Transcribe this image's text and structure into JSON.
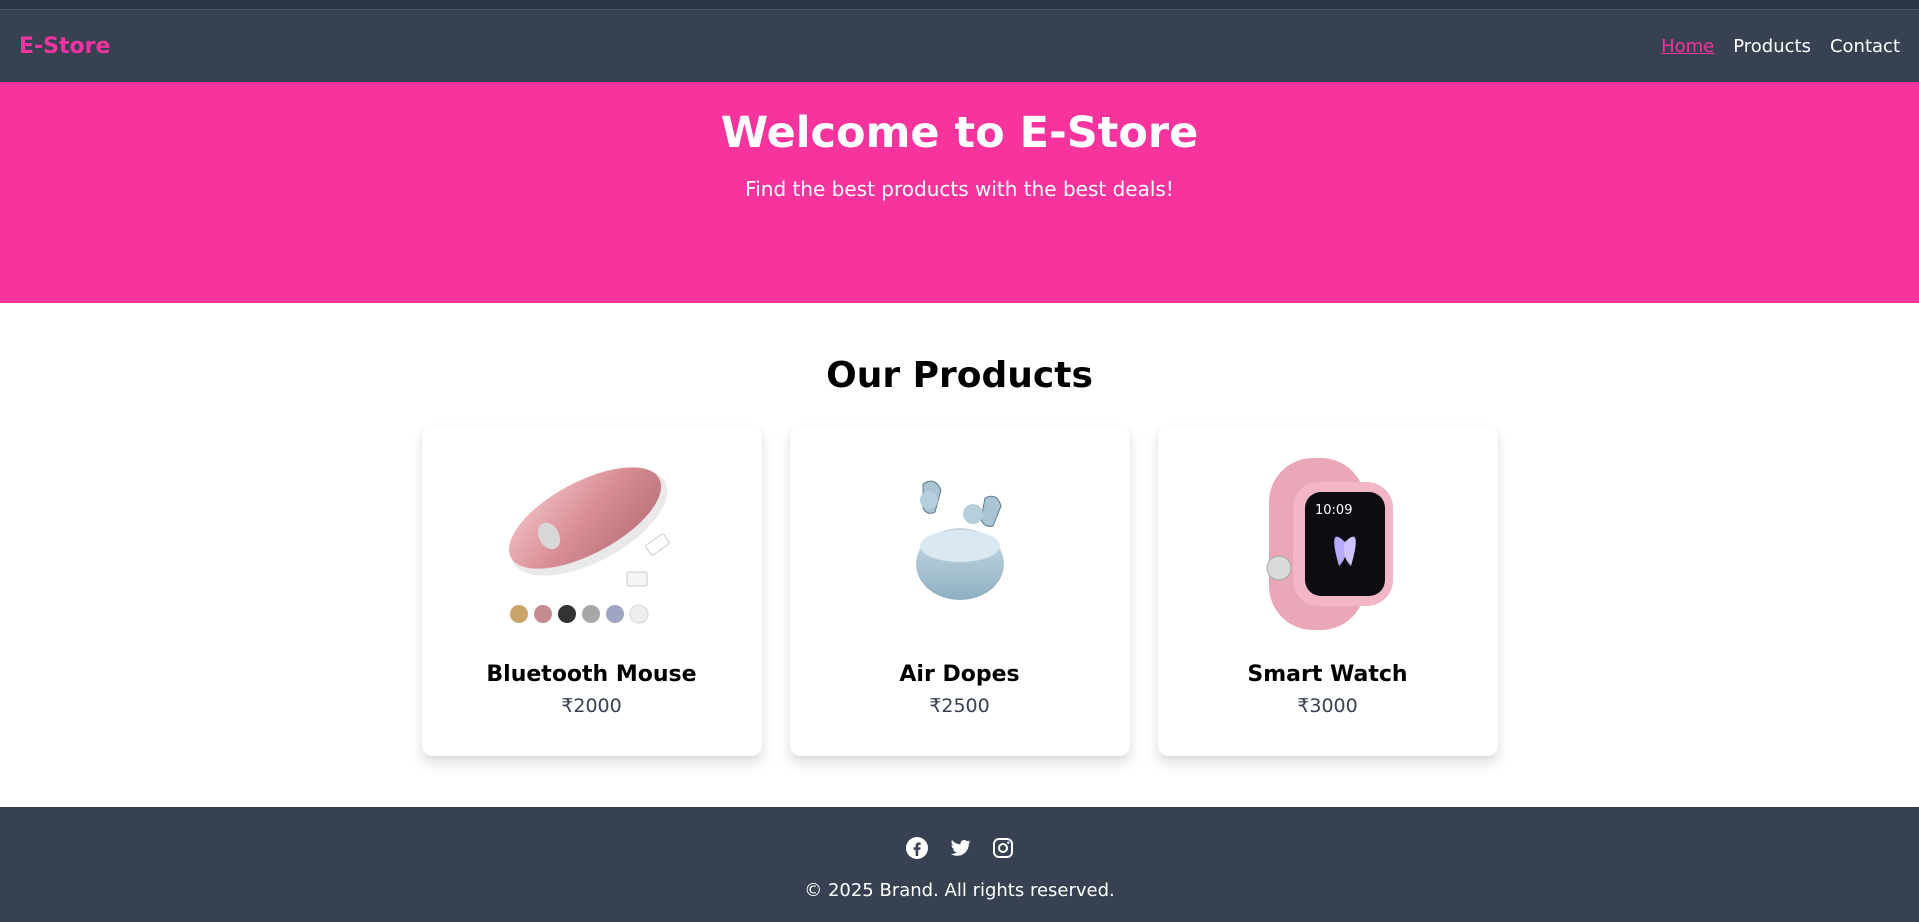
{
  "nav": {
    "brand": "E-Store",
    "links": [
      {
        "label": "Home",
        "active": true
      },
      {
        "label": "Products",
        "active": false
      },
      {
        "label": "Contact",
        "active": false
      }
    ]
  },
  "hero": {
    "title": "Welcome to E-Store",
    "subtitle": "Find the best products with the best deals!"
  },
  "products": {
    "title": "Our Products",
    "items": [
      {
        "name": "Bluetooth Mouse",
        "price": "₹2000",
        "image_icon": "mouse-image"
      },
      {
        "name": "Air Dopes",
        "price": "₹2500",
        "image_icon": "earbuds-image"
      },
      {
        "name": "Smart Watch",
        "price": "₹3000",
        "image_icon": "smartwatch-image"
      }
    ]
  },
  "footer": {
    "socials": [
      "facebook-icon",
      "twitter-icon",
      "instagram-icon"
    ],
    "copyright": "© 2025 Brand. All rights reserved."
  },
  "colors": {
    "accent": "#f7339d",
    "navbar": "#374151",
    "footer": "#374151"
  }
}
